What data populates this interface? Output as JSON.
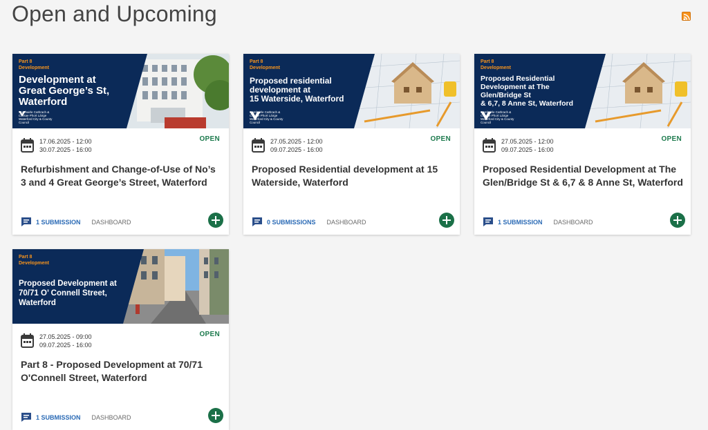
{
  "page": {
    "title": "Open and Upcoming",
    "rss_icon": "rss-icon"
  },
  "colors": {
    "banner_navy": "#0b2a58",
    "tag_orange": "#f7941d",
    "open_green": "#1e7b4e",
    "link_blue": "#2a6ab5",
    "add_button": "#1b7048"
  },
  "cards": [
    {
      "banner": {
        "tag_line1": "Part 8",
        "tag_line2": "Development",
        "title": [
          "Development at",
          "Great George’s St,",
          "Waterford"
        ],
        "logo_text": "Comhairle Cathrach & Contae Phort Láirge Waterford City & County Council"
      },
      "date_start": "17.06.2025 - 12:00",
      "date_end": "30.07.2025 - 16:00",
      "status": "OPEN",
      "title": "Refurbishment and Change-of-Use of No’s 3 and 4 Great George’s Street, Waterford",
      "submissions": "1 SUBMISSION",
      "dashboard": "DASHBOARD"
    },
    {
      "banner": {
        "tag_line1": "Part 8",
        "tag_line2": "Development",
        "title": [
          "Proposed residential",
          "development at",
          "15 Waterside, Waterford"
        ],
        "logo_text": "Comhairle Cathrach & Contae Phort Láirge Waterford City & County Council"
      },
      "date_start": "27.05.2025 - 12:00",
      "date_end": "09.07.2025 - 16:00",
      "status": "OPEN",
      "title": "Proposed Residential development at 15 Waterside, Waterford",
      "submissions": "0 SUBMISSIONS",
      "dashboard": "DASHBOARD"
    },
    {
      "banner": {
        "tag_line1": "Part 8",
        "tag_line2": "Development",
        "title": [
          "Proposed Residential",
          "Development at The",
          "Glen/Bridge St",
          "& 6,7, 8 Anne St, Waterford"
        ],
        "logo_text": "Comhairle Cathrach & Contae Phort Láirge Waterford City & County Council"
      },
      "date_start": "27.05.2025 - 12:00",
      "date_end": "09.07.2025 - 16:00",
      "status": "OPEN",
      "title": "Proposed Residential Development at The Glen/Bridge St & 6,7 & 8 Anne St, Waterford",
      "submissions": "1 SUBMISSION",
      "dashboard": "DASHBOARD"
    },
    {
      "banner": {
        "tag_line1": "Part 8",
        "tag_line2": "Development",
        "title": [
          "Proposed Development at",
          "70/71 O’ Connell Street,",
          "Waterford"
        ],
        "logo_text": ""
      },
      "date_start": "27.05.2025 - 09:00",
      "date_end": "09.07.2025 - 16:00",
      "status": "OPEN",
      "title": "Part 8 - Proposed Development at 70/71 O'Connell Street, Waterford",
      "submissions": "1 SUBMISSION",
      "dashboard": "DASHBOARD"
    }
  ]
}
